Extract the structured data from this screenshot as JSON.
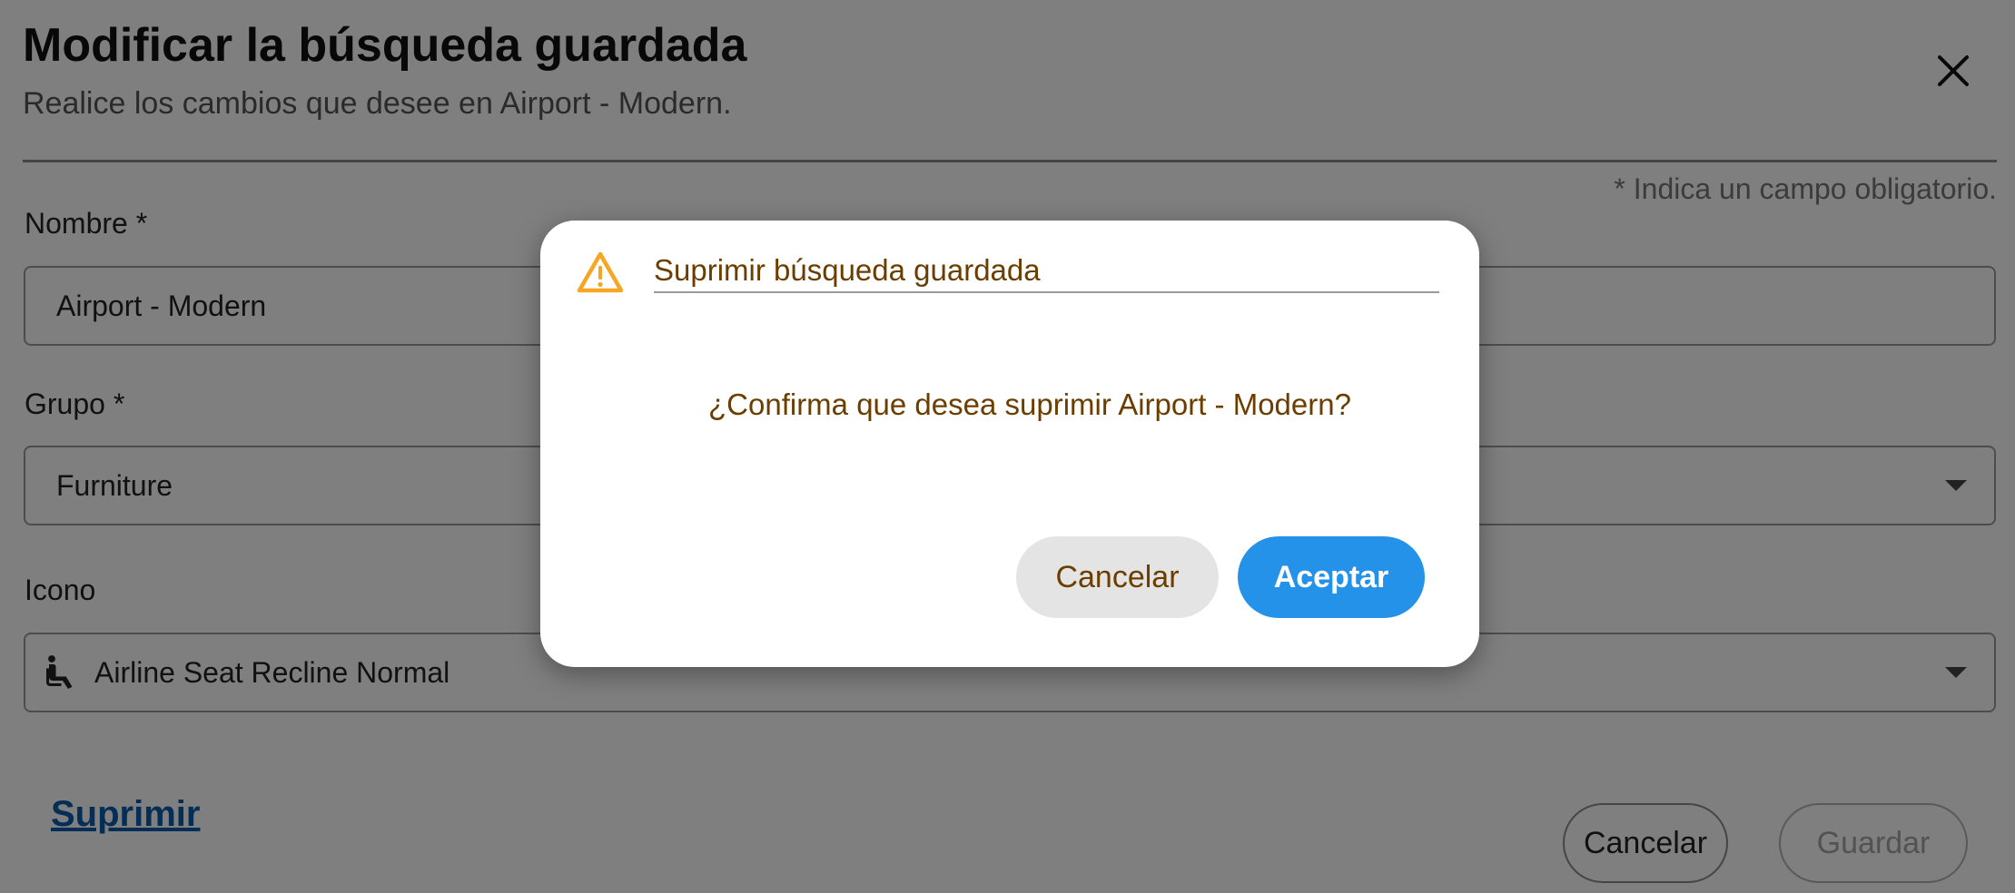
{
  "dialog": {
    "title": "Modificar la búsqueda guardada",
    "subtitle": "Realice los cambios que desee en Airport - Modern.",
    "required_note": "* Indica un campo obligatorio.",
    "close_icon": "close-icon"
  },
  "form": {
    "name_label": "Nombre *",
    "name_value": "Airport - Modern",
    "group_label": "Grupo *",
    "group_value": "Furniture",
    "icon_label": "Icono",
    "icon_value": "Airline Seat Recline Normal",
    "icon_glyph": "airline-seat-recline-icon"
  },
  "footer": {
    "delete_label": "Suprimir",
    "cancel_label": "Cancelar",
    "save_label": "Guardar"
  },
  "confirm_modal": {
    "title": "Suprimir búsqueda guardada",
    "message": "¿Confirma que desea suprimir Airport - Modern?",
    "cancel_label": "Cancelar",
    "accept_label": "Aceptar",
    "icon": "warning-icon",
    "colors": {
      "text": "#6b3e00",
      "accept": "#2592ea",
      "warning": "#f5a623"
    }
  }
}
